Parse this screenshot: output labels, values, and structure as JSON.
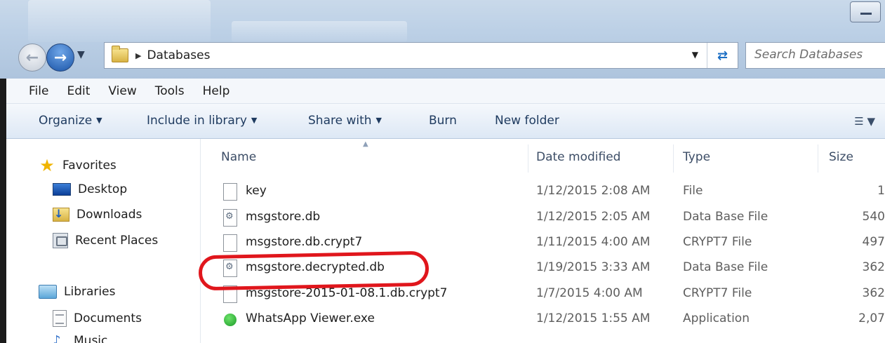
{
  "window": {
    "breadcrumb": [
      "Databases"
    ],
    "search_placeholder": "Search Databases"
  },
  "icons": {
    "back": "back-arrow-icon",
    "forward": "forward-arrow-icon",
    "refresh": "refresh-icon",
    "folder": "folder-icon",
    "view": "view-options-icon"
  },
  "menu": [
    "File",
    "Edit",
    "View",
    "Tools",
    "Help"
  ],
  "commands": {
    "organize": "Organize",
    "include_in_library": "Include in library",
    "share_with": "Share with",
    "burn": "Burn",
    "new_folder": "New folder"
  },
  "nav": {
    "favorites": "Favorites",
    "desktop": "Desktop",
    "downloads": "Downloads",
    "recent_places": "Recent Places",
    "libraries": "Libraries",
    "documents": "Documents",
    "music": "Music"
  },
  "columns": {
    "name": "Name",
    "date": "Date modified",
    "type": "Type",
    "size": "Size"
  },
  "files": [
    {
      "name": "key",
      "date": "1/12/2015 2:08 AM",
      "type": "File",
      "size": "1",
      "icon": "file-icon"
    },
    {
      "name": "msgstore.db",
      "date": "1/12/2015 2:05 AM",
      "type": "Data Base File",
      "size": "540",
      "icon": "db-file-icon"
    },
    {
      "name": "msgstore.db.crypt7",
      "date": "1/11/2015 4:00 AM",
      "type": "CRYPT7 File",
      "size": "497",
      "icon": "file-icon"
    },
    {
      "name": "msgstore.decrypted.db",
      "date": "1/19/2015 3:33 AM",
      "type": "Data Base File",
      "size": "362",
      "icon": "db-file-icon"
    },
    {
      "name": "msgstore-2015-01-08.1.db.crypt7",
      "date": "1/7/2015 4:00 AM",
      "type": "CRYPT7 File",
      "size": "362",
      "icon": "file-icon"
    },
    {
      "name": "WhatsApp Viewer.exe",
      "date": "1/12/2015 1:55 AM",
      "type": "Application",
      "size": "2,07",
      "icon": "whatsapp-app-icon"
    }
  ],
  "colors": {
    "highlight": "#e0161c",
    "accent": "#1b55a8"
  }
}
